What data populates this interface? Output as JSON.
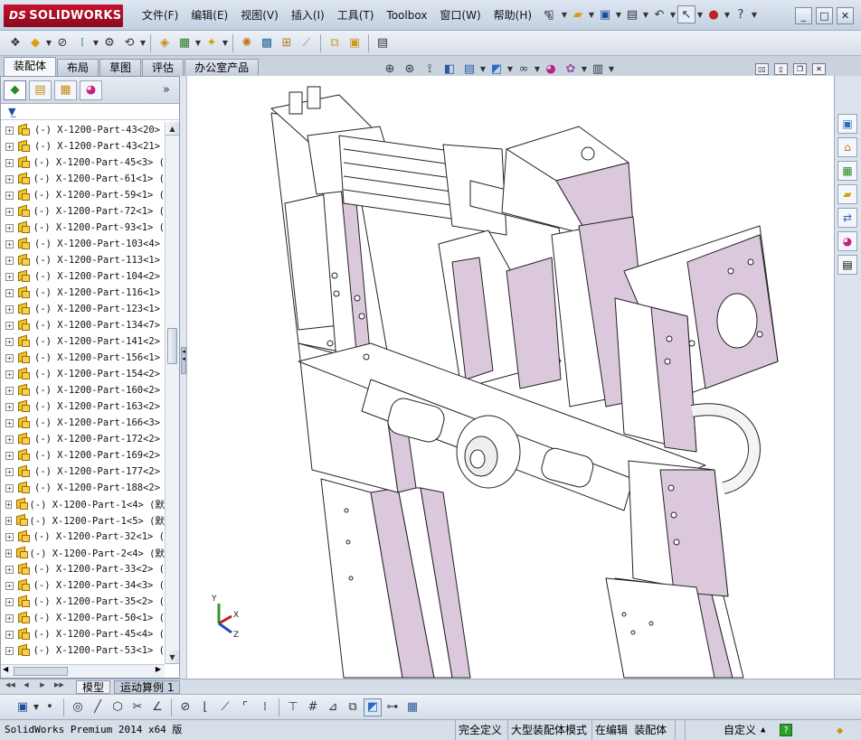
{
  "app": {
    "logo_mark": "DS",
    "logo_text": "SOLIDWORKS"
  },
  "menu": {
    "items": [
      "文件(F)",
      "编辑(E)",
      "视图(V)",
      "插入(I)",
      "工具(T)",
      "Toolbox",
      "窗口(W)",
      "帮助(H)"
    ]
  },
  "command_tabs": [
    "装配体",
    "布局",
    "草图",
    "评估",
    "办公室产品"
  ],
  "tree": {
    "items": [
      "(-) X-1200-Part-43<20>",
      "(-) X-1200-Part-43<21>",
      "(-) X-1200-Part-45<3> (",
      "(-) X-1200-Part-61<1> (",
      "(-) X-1200-Part-59<1> (",
      "(-) X-1200-Part-72<1> (",
      "(-) X-1200-Part-93<1> (",
      "(-) X-1200-Part-103<4>",
      "(-) X-1200-Part-113<1>",
      "(-) X-1200-Part-104<2>",
      "(-) X-1200-Part-116<1>",
      "(-) X-1200-Part-123<1>",
      "(-) X-1200-Part-134<7>",
      "(-) X-1200-Part-141<2>",
      "(-) X-1200-Part-156<1>",
      "(-) X-1200-Part-154<2>",
      "(-) X-1200-Part-160<2>",
      "(-) X-1200-Part-163<2>",
      "(-) X-1200-Part-166<3>",
      "(-) X-1200-Part-172<2>",
      "(-) X-1200-Part-169<2>",
      "(-) X-1200-Part-177<2>",
      "(-) X-1200-Part-188<2>",
      "(-) X-1200-Part-1<4> (默",
      "(-) X-1200-Part-1<5> (默",
      "(-) X-1200-Part-32<1> (",
      "(-) X-1200-Part-2<4> (默",
      "(-) X-1200-Part-33<2> (",
      "(-) X-1200-Part-34<3> (",
      "(-) X-1200-Part-35<2> (",
      "(-) X-1200-Part-50<1> (",
      "(-) X-1200-Part-45<4> (",
      "(-) X-1200-Part-53<1> ("
    ]
  },
  "bottom_tabs": [
    "模型",
    "运动算例 1"
  ],
  "status": {
    "product": "SolidWorks Premium 2014 x64 版",
    "fully_defined": "完全定义",
    "large_assembly": "大型装配体模式",
    "editing": "在编辑 装配体",
    "custom": "自定义",
    "help_icon": "?"
  },
  "triad": {
    "x": "X",
    "y": "Y",
    "z": "Z"
  },
  "colors": {
    "part_pink": "#dcc8dc",
    "part_white": "#ffffff",
    "brand_red": "#c8102e"
  }
}
